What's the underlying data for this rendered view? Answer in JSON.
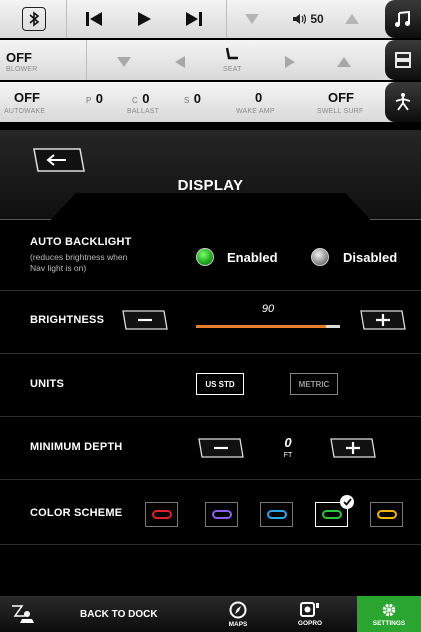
{
  "top_bar": {
    "bluetooth_icon": "bluetooth-icon",
    "volume": "50",
    "music_icon": "music-note-icon"
  },
  "blower_bar": {
    "blower_value": "OFF",
    "blower_label": "BLOWER",
    "seat_label": "SEAT"
  },
  "status_bar": {
    "autowake_value": "OFF",
    "autowake_label": "AUTOWAKE",
    "ballast_p_prefix": "P",
    "ballast_p_value": "0",
    "ballast_c_prefix": "C",
    "ballast_c_value": "0",
    "ballast_label": "BALLAST",
    "ballast_s_prefix": "S",
    "ballast_s_value": "0",
    "wake_amp_value": "0",
    "wake_amp_label": "WAKE AMP",
    "swell_surf_value": "OFF",
    "swell_surf_label": "SWELL SURF"
  },
  "page": {
    "title": "DISPLAY"
  },
  "auto_backlight": {
    "label": "AUTO BACKLIGHT",
    "subtext_line1": "(reduces brightness when",
    "subtext_line2": "Nav light is on)",
    "enabled_label": "Enabled",
    "disabled_label": "Disabled",
    "selected": "Enabled"
  },
  "brightness": {
    "label": "BRIGHTNESS",
    "value": "90",
    "level_percent": 90
  },
  "units": {
    "label": "UNITS",
    "options": [
      "US STD",
      "METRIC"
    ],
    "selected": "US STD"
  },
  "minimum_depth": {
    "label": "MINIMUM DEPTH",
    "value": "0",
    "unit": "FT"
  },
  "color_scheme": {
    "label": "COLOR SCHEME",
    "swatches": [
      {
        "color": "#e0202a"
      },
      {
        "color": "#8a5cf0"
      },
      {
        "color": "#2aa7e8"
      },
      {
        "color": "#28c83c"
      },
      {
        "color": "#f2b400"
      }
    ],
    "selected_index": 3
  },
  "footer": {
    "back_label": "BACK TO DOCK",
    "maps_label": "MAPS",
    "gopro_label": "GOPRO",
    "settings_label": "SETTINGS",
    "active_tab": "SETTINGS",
    "active_color": "#2aa52f"
  }
}
